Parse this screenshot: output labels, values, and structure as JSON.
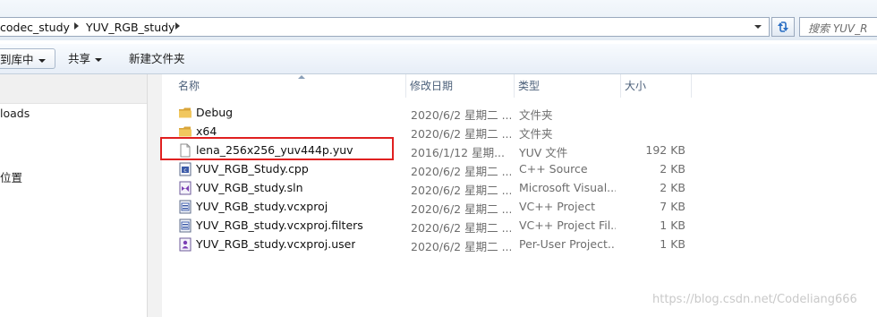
{
  "address_bar": {
    "crumbs": [
      "codec_study",
      "YUV_RGB_study"
    ],
    "search_placeholder": "搜索 YUV_R"
  },
  "toolbar": {
    "include_library_label": "到库中",
    "share_label": "共享",
    "new_folder_label": "新建文件夹"
  },
  "nav": {
    "items": [
      "loads",
      "位置"
    ]
  },
  "columns": {
    "name": "名称",
    "date": "修改日期",
    "type": "类型",
    "size": "大小"
  },
  "files": [
    {
      "name": "Debug",
      "date": "2020/6/2 星期二 ...",
      "type": "文件夹",
      "size": "",
      "icon": "folder-icon"
    },
    {
      "name": "x64",
      "date": "2020/6/2 星期二 ...",
      "type": "文件夹",
      "size": "",
      "icon": "folder-icon"
    },
    {
      "name": "lena_256x256_yuv444p.yuv",
      "date": "2016/1/12 星期...",
      "type": "YUV 文件",
      "size": "192 KB",
      "icon": "blank-file-icon",
      "highlighted": true
    },
    {
      "name": "YUV_RGB_Study.cpp",
      "date": "2020/6/2 星期二 ...",
      "type": "C++ Source",
      "size": "2 KB",
      "icon": "cpp-file-icon"
    },
    {
      "name": "YUV_RGB_study.sln",
      "date": "2020/6/2 星期二 ...",
      "type": "Microsoft Visual...",
      "size": "2 KB",
      "icon": "sln-file-icon"
    },
    {
      "name": "YUV_RGB_study.vcxproj",
      "date": "2020/6/2 星期二 ...",
      "type": "VC++ Project",
      "size": "7 KB",
      "icon": "vcxproj-file-icon"
    },
    {
      "name": "YUV_RGB_study.vcxproj.filters",
      "date": "2020/6/2 星期二 ...",
      "type": "VC++ Project Fil...",
      "size": "1 KB",
      "icon": "vcxproj-file-icon"
    },
    {
      "name": "YUV_RGB_study.vcxproj.user",
      "date": "2020/6/2 星期二 ...",
      "type": "Per-User Project...",
      "size": "1 KB",
      "icon": "user-file-icon"
    }
  ],
  "watermark": "https://blog.csdn.net/Codeliang666",
  "colors": {
    "highlight": "#e02020",
    "folder": "#e8b94a",
    "header_text": "#4c607a"
  }
}
